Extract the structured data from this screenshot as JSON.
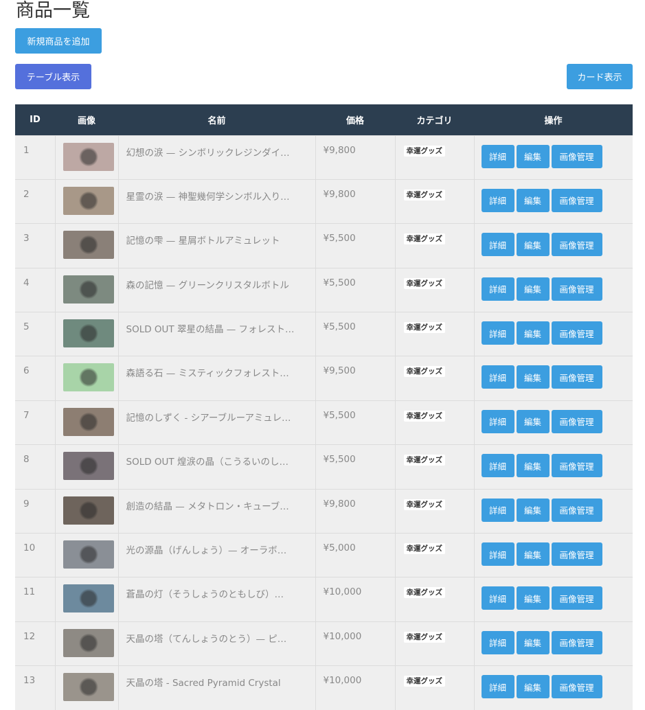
{
  "page": {
    "title": "商品一覧"
  },
  "toolbar": {
    "add_label": "新規商品を追加",
    "table_view_label": "テーブル表示",
    "card_view_label": "カード表示"
  },
  "table": {
    "headers": {
      "id": "ID",
      "image": "画像",
      "name": "名前",
      "price": "価格",
      "category": "カテゴリ",
      "actions": "操作"
    },
    "action_labels": {
      "detail": "詳細",
      "edit": "編集",
      "images": "画像管理"
    },
    "rows": [
      {
        "id": "1",
        "name": "幻想の涙 — シンボリックレジンダイ…",
        "price": "¥9,800",
        "category": "幸運グッズ",
        "thumb_color": "#bda8a4"
      },
      {
        "id": "2",
        "name": "星霊の涙 — 神聖幾何学シンボル入り…",
        "price": "¥9,800",
        "category": "幸運グッズ",
        "thumb_color": "#a89888"
      },
      {
        "id": "3",
        "name": "記憶の雫 — 星屑ボトルアミュレット",
        "price": "¥5,500",
        "category": "幸運グッズ",
        "thumb_color": "#8a8078"
      },
      {
        "id": "4",
        "name": "森の記憶 — グリーンクリスタルボトル",
        "price": "¥5,500",
        "category": "幸運グッズ",
        "thumb_color": "#7d8a80"
      },
      {
        "id": "5",
        "name": "SOLD OUT 翠星の結晶 — フォレスト…",
        "price": "¥5,500",
        "category": "幸運グッズ",
        "thumb_color": "#6f8a7e"
      },
      {
        "id": "6",
        "name": "森語る石 — ミスティックフォレスト…",
        "price": "¥9,500",
        "category": "幸運グッズ",
        "thumb_color": "#a8d4a8"
      },
      {
        "id": "7",
        "name": "記憶のしずく - シアーブルーアミュレ…",
        "price": "¥5,500",
        "category": "幸運グッズ",
        "thumb_color": "#8d7e72"
      },
      {
        "id": "8",
        "name": "SOLD OUT 煌涙の晶（こうるいのし…",
        "price": "¥5,500",
        "category": "幸運グッズ",
        "thumb_color": "#7a7278"
      },
      {
        "id": "9",
        "name": "創造の結晶 — メタトロン・キューブ…",
        "price": "¥9,800",
        "category": "幸運グッズ",
        "thumb_color": "#6e645c"
      },
      {
        "id": "10",
        "name": "光の源晶（げんしょう）— オーラボ…",
        "price": "¥5,000",
        "category": "幸運グッズ",
        "thumb_color": "#8a8f96"
      },
      {
        "id": "11",
        "name": "蒼晶の灯（そうしょうのともしび）…",
        "price": "¥10,000",
        "category": "幸運グッズ",
        "thumb_color": "#6d8a9e"
      },
      {
        "id": "12",
        "name": "天晶の塔（てんしょうのとう）— ピ…",
        "price": "¥10,000",
        "category": "幸運グッズ",
        "thumb_color": "#8e8a84"
      },
      {
        "id": "13",
        "name": "天晶の塔 - Sacred Pyramid Crystal",
        "price": "¥10,000",
        "category": "幸運グッズ",
        "thumb_color": "#9a948c"
      }
    ]
  },
  "colors": {
    "header_bg": "#2c3e50",
    "accent": "#3c9ee0",
    "accent_active": "#5470dc",
    "row_bg": "#efefef"
  }
}
